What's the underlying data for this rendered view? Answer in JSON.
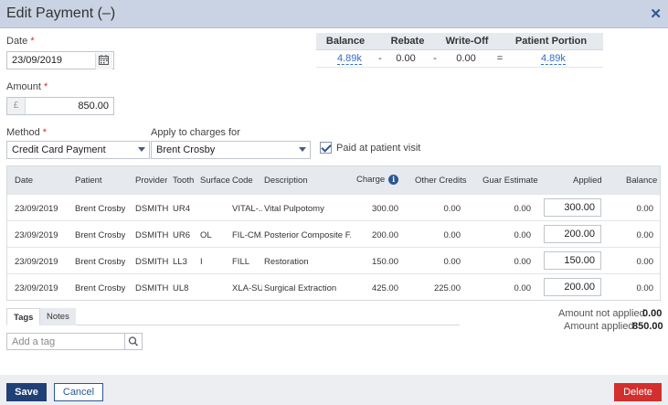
{
  "dialog": {
    "title": "Edit Payment (–)",
    "close": "✕"
  },
  "date": {
    "label": "Date",
    "required": "*",
    "value": "23/09/2019"
  },
  "amount": {
    "label": "Amount",
    "required": "*",
    "currency": "£",
    "value": "850.00"
  },
  "method": {
    "label": "Method",
    "required": "*",
    "value": "Credit Card Payment"
  },
  "apply_to": {
    "label": "Apply to charges for",
    "value": "Brent Crosby"
  },
  "paid_at_visit": {
    "label": "Paid at patient visit",
    "checked": true
  },
  "summary": {
    "headers": [
      "Balance",
      "Rebate",
      "Write-Off",
      "Patient Portion"
    ],
    "balance": "4.89k",
    "op1": "-",
    "rebate": "0.00",
    "op2": "-",
    "writeoff": "0.00",
    "op3": "=",
    "patient_portion": "4.89k"
  },
  "grid": {
    "headers": [
      "Date",
      "Patient",
      "Provider",
      "Tooth",
      "Surface",
      "Code",
      "Description",
      "Charge",
      "Other Credits",
      "Guar Estimate",
      "Applied",
      "Balance"
    ],
    "rows": [
      {
        "date": "23/09/2019",
        "patient": "Brent Crosby",
        "provider": "DSMITH",
        "tooth": "UR4",
        "surface": "",
        "code": "VITAL-...",
        "description": "Vital Pulpotomy",
        "charge": "300.00",
        "other_credits": "0.00",
        "guar_estimate": "0.00",
        "applied": "300.00",
        "balance": "0.00"
      },
      {
        "date": "23/09/2019",
        "patient": "Brent Crosby",
        "provider": "DSMITH",
        "tooth": "UR6",
        "surface": "OL",
        "code": "FIL-CM...",
        "description": "Posterior Composite F...",
        "charge": "200.00",
        "other_credits": "0.00",
        "guar_estimate": "0.00",
        "applied": "200.00",
        "balance": "0.00"
      },
      {
        "date": "23/09/2019",
        "patient": "Brent Crosby",
        "provider": "DSMITH",
        "tooth": "LL3",
        "surface": "I",
        "code": "FILL",
        "description": "Restoration",
        "charge": "150.00",
        "other_credits": "0.00",
        "guar_estimate": "0.00",
        "applied": "150.00",
        "balance": "0.00"
      },
      {
        "date": "23/09/2019",
        "patient": "Brent Crosby",
        "provider": "DSMITH",
        "tooth": "UL8",
        "surface": "",
        "code": "XLA-SU...",
        "description": "Surgical Extraction",
        "charge": "425.00",
        "other_credits": "225.00",
        "guar_estimate": "0.00",
        "applied": "200.00",
        "balance": "0.00"
      }
    ]
  },
  "tabs": {
    "tags": "Tags",
    "notes": "Notes"
  },
  "tag_input": {
    "placeholder": "Add a tag"
  },
  "totals": {
    "not_applied_label": "Amount not applied",
    "not_applied_value": "0.00",
    "applied_label": "Amount applied",
    "applied_value": "850.00"
  },
  "footer": {
    "save": "Save",
    "cancel": "Cancel",
    "delete": "Delete"
  },
  "colors": {
    "primary": "#1f3f77",
    "danger": "#d32f2f",
    "link": "#2f6fc4",
    "titlebar": "#c9d3e3"
  }
}
